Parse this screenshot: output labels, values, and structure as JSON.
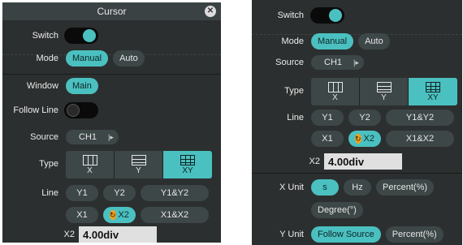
{
  "left": {
    "title": "Cursor",
    "close_icon": "close-icon",
    "switch_label": "Switch",
    "mode_label": "Mode",
    "mode_options": [
      "Manual",
      "Auto"
    ],
    "mode_selected": "Manual",
    "window_label": "Window",
    "window_value": "Main",
    "follow_line_label": "Follow Line",
    "source_label": "Source",
    "source_value": "CH1",
    "type_label": "Type",
    "type_options": [
      "X",
      "Y",
      "XY"
    ],
    "type_selected": "XY",
    "line_label": "Line",
    "line_options_row1": [
      "Y1",
      "Y2",
      "Y1&Y2"
    ],
    "line_options_row2": [
      "X1",
      "X2",
      "X1&X2"
    ],
    "line_selected": "X2",
    "x2_label": "X2",
    "x2_value": "4.00div"
  },
  "right": {
    "switch_label": "Switch",
    "mode_label": "Mode",
    "mode_options": [
      "Manual",
      "Auto"
    ],
    "source_label": "Source",
    "source_value": "CH1",
    "type_label": "Type",
    "type_options": [
      "X",
      "Y",
      "XY"
    ],
    "line_label": "Line",
    "line_options_row1": [
      "Y1",
      "Y2",
      "Y1&Y2"
    ],
    "line_options_row2": [
      "X1",
      "X2",
      "X1&X2"
    ],
    "x2_label": "X2",
    "x2_value": "4.00div",
    "xunit_label": "X Unit",
    "xunit_options": [
      "s",
      "Hz",
      "Percent(%)",
      "Degree(°)"
    ],
    "xunit_selected": "s",
    "yunit_label": "Y Unit",
    "yunit_options": [
      "Follow Source",
      "Percent(%)"
    ],
    "yunit_selected": "Follow Source"
  },
  "colors": {
    "accent": "#4bc0c0",
    "panel": "#2c2f2f",
    "pill": "#3d4747",
    "highlight": "#f2a01e"
  }
}
